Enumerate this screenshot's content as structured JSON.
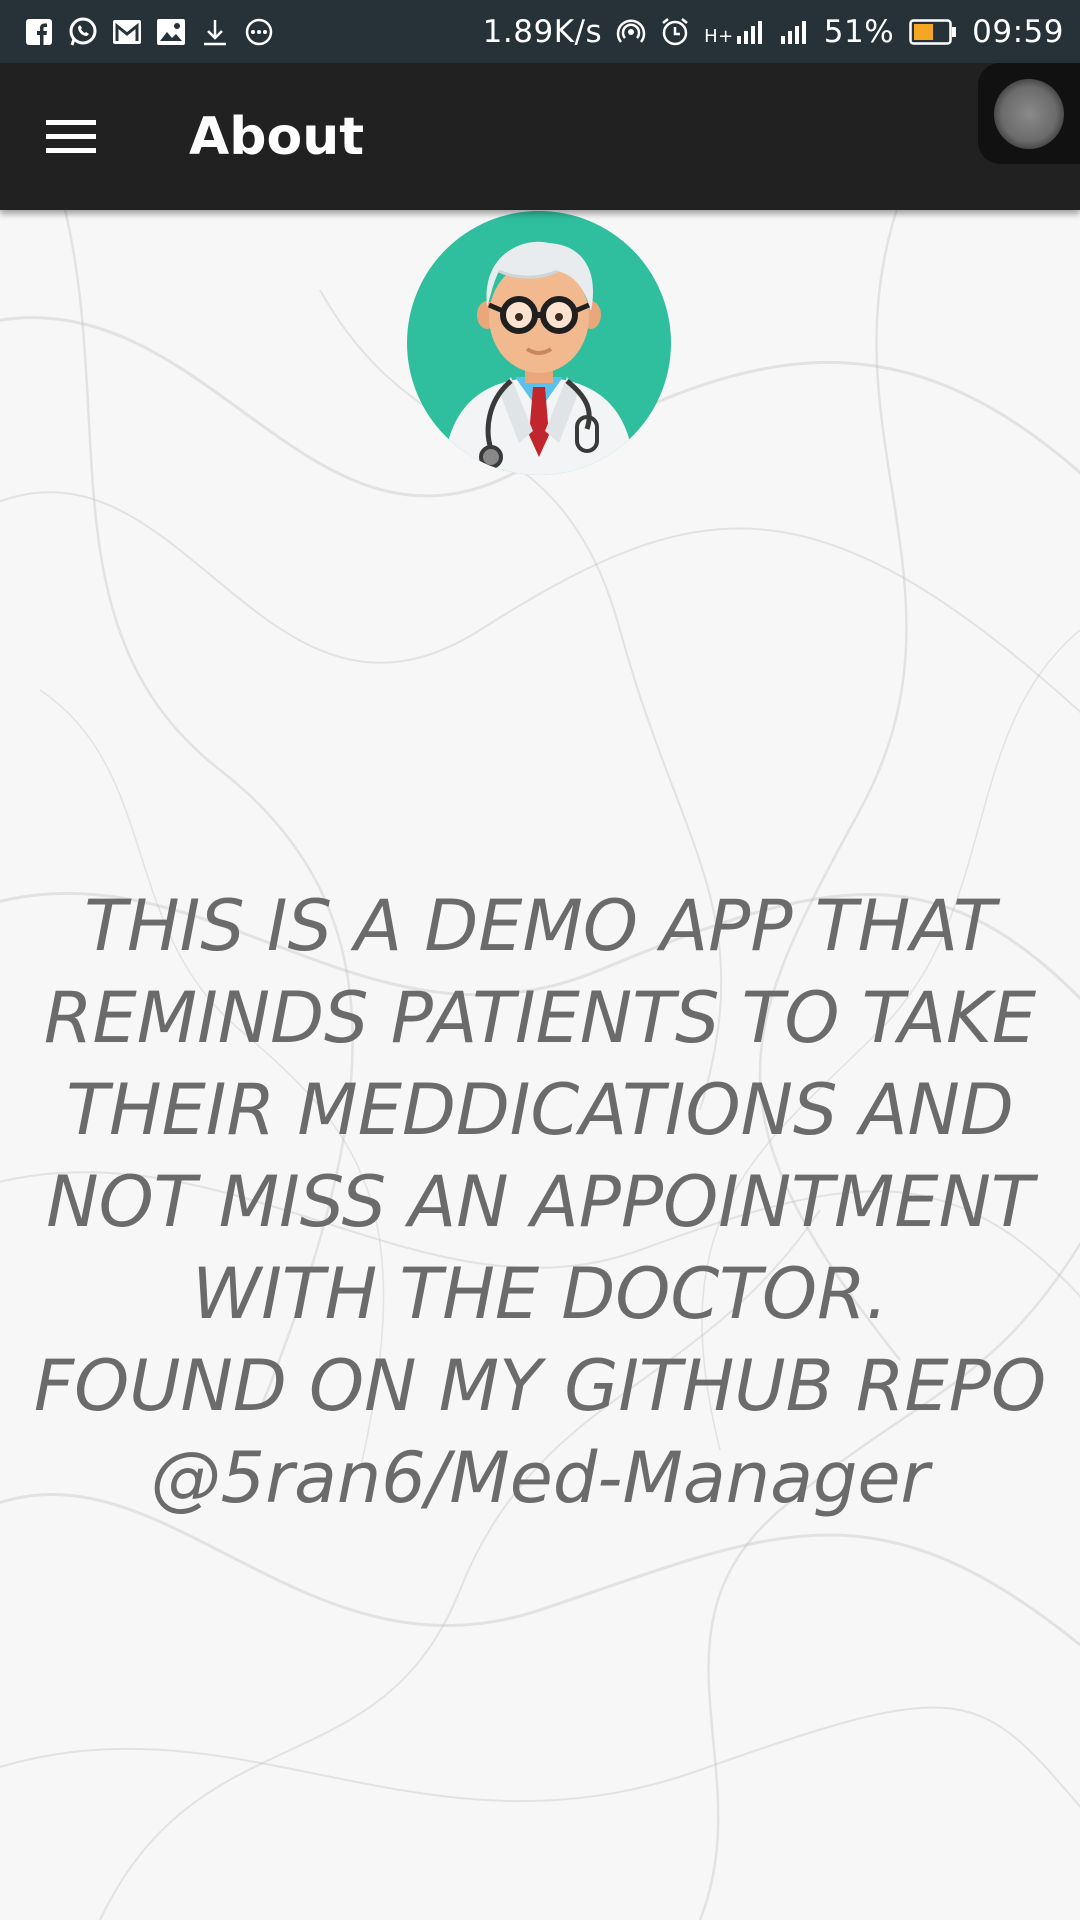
{
  "status_bar": {
    "notification_icons": [
      "facebook-icon",
      "whatsapp-icon",
      "gmail-icon",
      "gallery-icon",
      "download-icon",
      "more-icon"
    ],
    "network_speed": "1.89K/s",
    "network_type": "H+",
    "battery_percent": "51%",
    "time": "09:59"
  },
  "app_bar": {
    "title": "About",
    "background": "#212121"
  },
  "content": {
    "avatar": "doctor-icon",
    "description": "THIS IS A DEMO APP THAT REMINDS PATIENTS TO TAKE THEIR MEDDICATIONS AND NOT MISS AN APPOINTMENT WITH THE DOCTOR.\nFOUND ON MY GITHUB REPO @5ran6/Med-Manager"
  },
  "colors": {
    "status_bar": "#263238",
    "avatar_bg": "#2fbf9f",
    "text": "#6b6b6b"
  }
}
